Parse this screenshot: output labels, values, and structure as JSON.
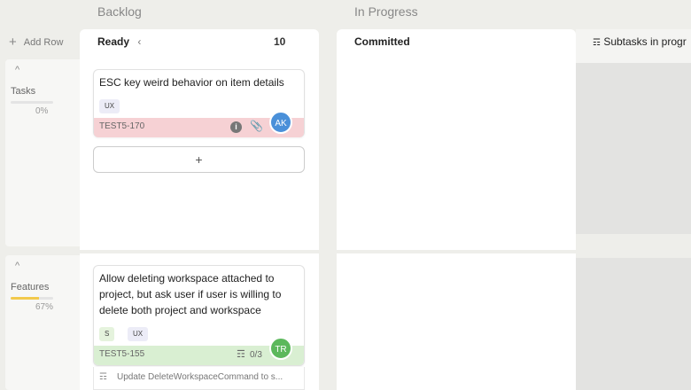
{
  "columns": {
    "backlog": "Backlog",
    "in_progress": "In Progress"
  },
  "add_row": "Add Row",
  "lanes": {
    "ready": "Ready",
    "ready_count": "10",
    "committed": "Committed",
    "subtasks": "Subtasks in progr"
  },
  "rows": [
    {
      "name": "Tasks",
      "percent": "0%",
      "progress": 0
    },
    {
      "name": "Features",
      "percent": "67%",
      "progress": 0.67
    }
  ],
  "cards": [
    {
      "title": "ESC key weird behavior on item details",
      "tags": [
        "UX"
      ],
      "id": "TEST5-170",
      "avatar": "AK",
      "avatar_color": "#4a90d9",
      "footer_color": "#f6d1d4"
    },
    {
      "title": "Allow deleting workspace attached to project, but ask user if user is willing to delete both project and workspace",
      "tags": [
        "S",
        "UX"
      ],
      "id": "TEST5-155",
      "subtask_count": "0/3",
      "avatar": "TR",
      "avatar_color": "#5cb85c",
      "footer_color": "#d9efd2",
      "subtask": "Update DeleteWorkspaceCommand to s..."
    }
  ],
  "add_card": "+",
  "colors": {
    "accent_yellow": "#f2c94c",
    "panel": "#ffffff",
    "background": "#eeeeea"
  }
}
